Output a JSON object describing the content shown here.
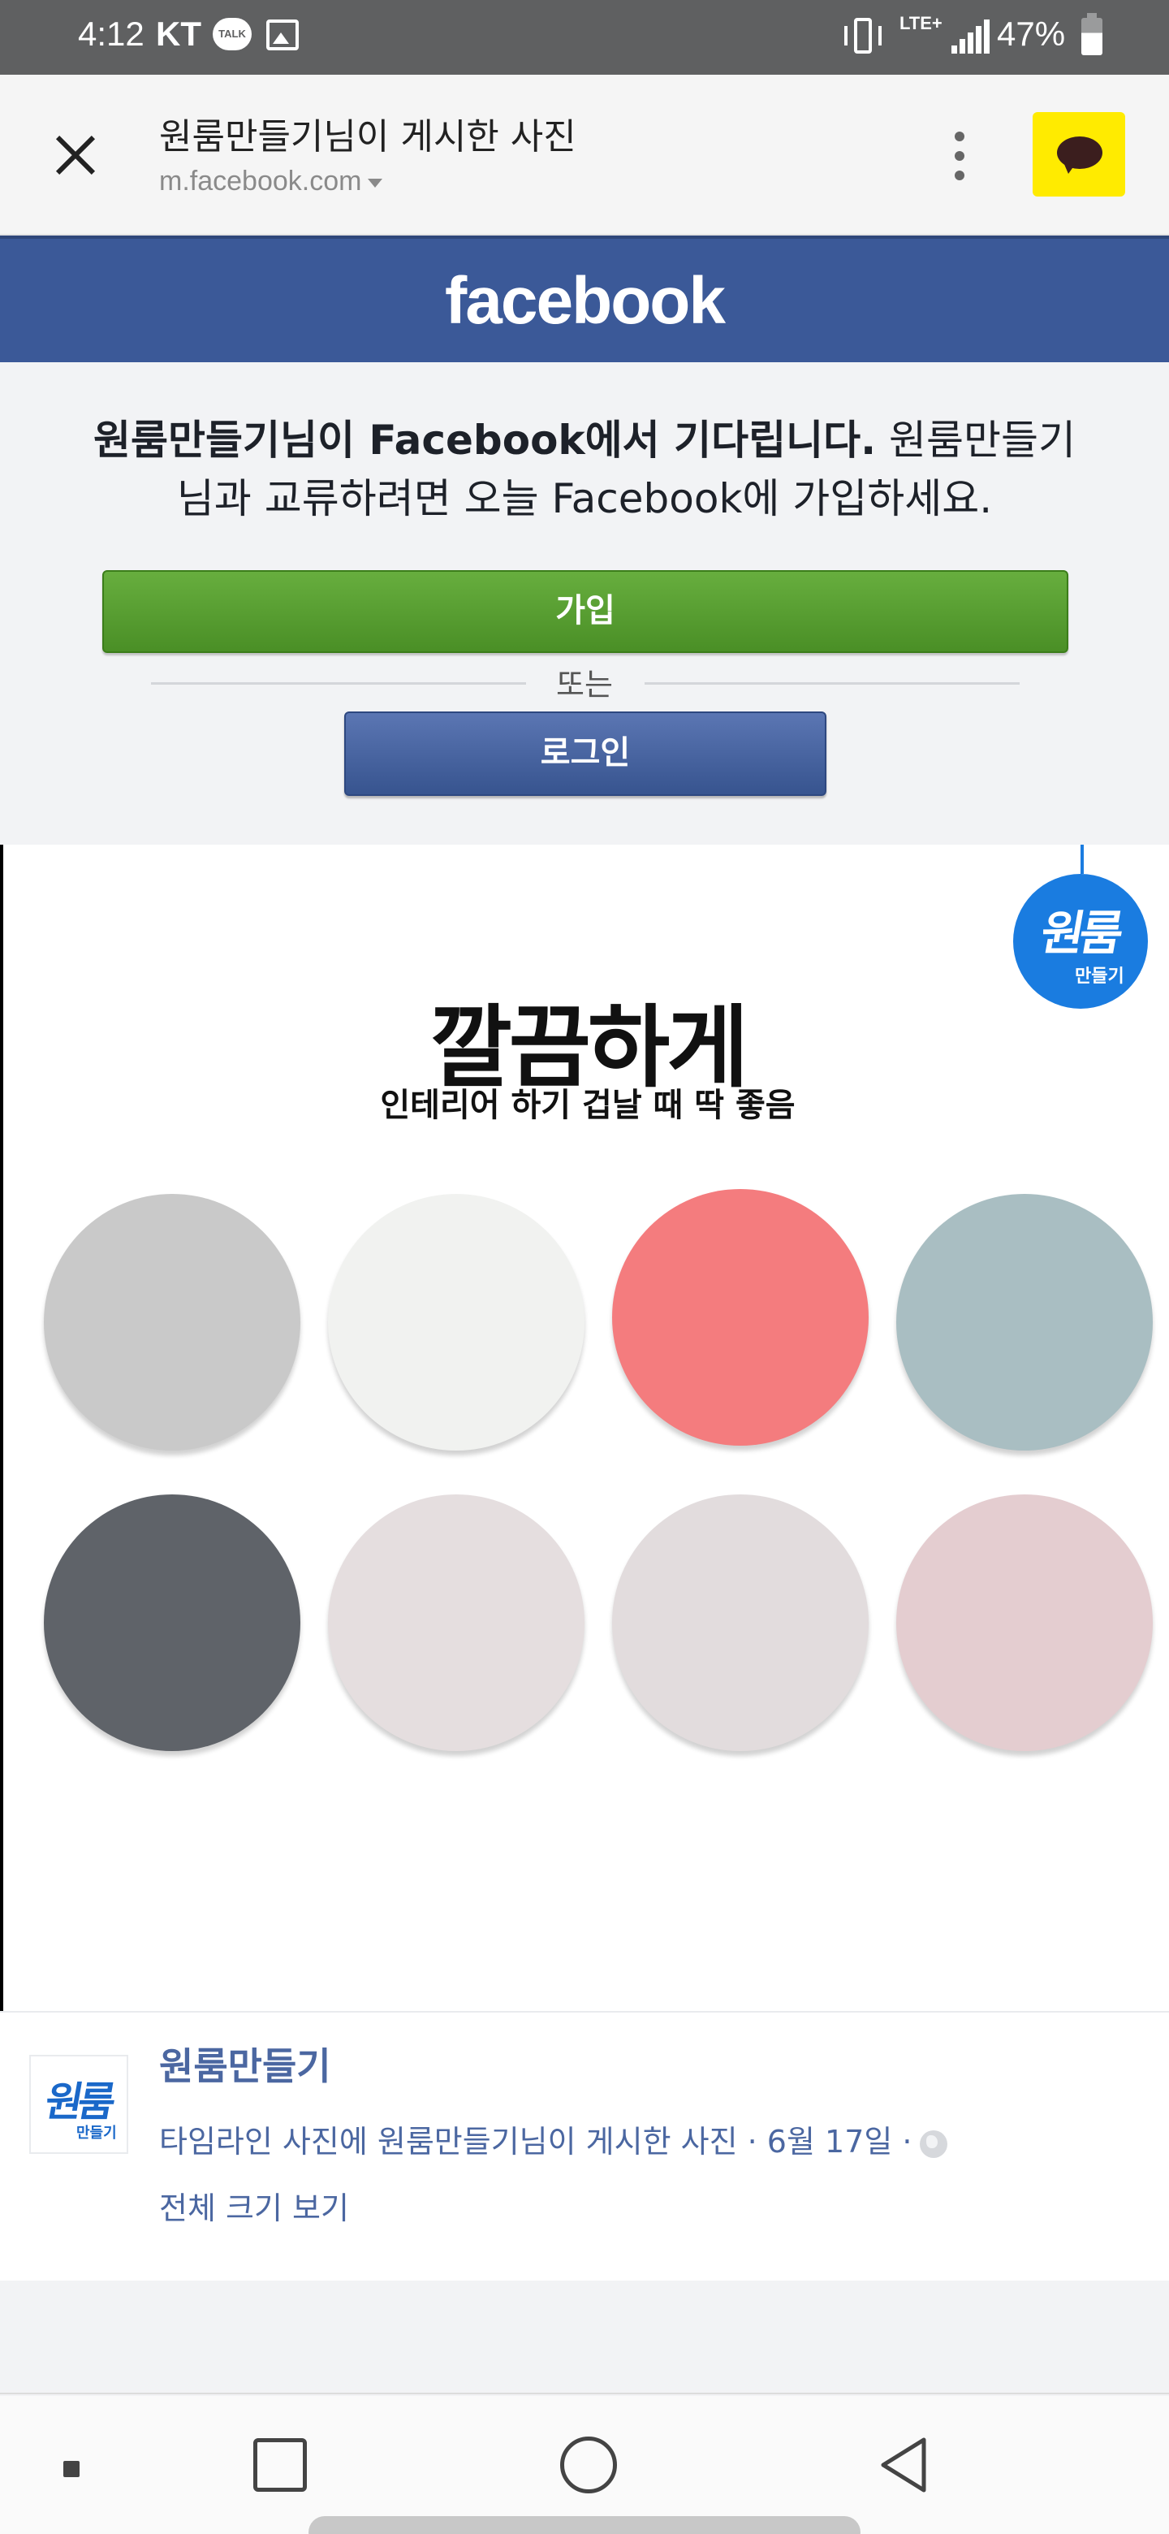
{
  "status_bar": {
    "time": "4:12",
    "carrier": "KT",
    "talk_badge": "TALK",
    "network": "LTE+",
    "battery_percent": "47%",
    "icons": [
      "talk-icon",
      "gallery-icon",
      "vibrate-icon",
      "signal-icon",
      "battery-icon"
    ]
  },
  "browser": {
    "title": "원룸만들기님이 게시한 사진",
    "url": "m.facebook.com"
  },
  "facebook": {
    "logo": "facebook",
    "message_bold": "원룸만들기님이 Facebook에서 기다립니다.",
    "message_rest": " 원룸만들기님과 교류하려면 오늘 Facebook에 가입하세요.",
    "join_label": "가입",
    "or_label": "또는",
    "login_label": "로그인"
  },
  "photo": {
    "badge_main": "원룸",
    "badge_sub": "만들기",
    "title": "깔끔하게",
    "subtitle": "인테리어 하기 겁날 때 딱 좋음",
    "swatches": [
      "#c9c9c9",
      "#f1f2f0",
      "#f47c7e",
      "#a9bec2",
      "#5f6369",
      "#e5dedf",
      "#e2dcdd",
      "#e4cdd0"
    ]
  },
  "post": {
    "page_name": "원룸만들기",
    "meta": "타임라인 사진에 원룸만들기님이 게시한 사진 · 6월 17일 ·",
    "full_size_link": "전체 크기 보기"
  },
  "colors": {
    "facebook_blue": "#3b5998",
    "join_green": "#5a9e33",
    "kakao_yellow": "#ffeb00",
    "link_blue": "#4b67a1"
  }
}
